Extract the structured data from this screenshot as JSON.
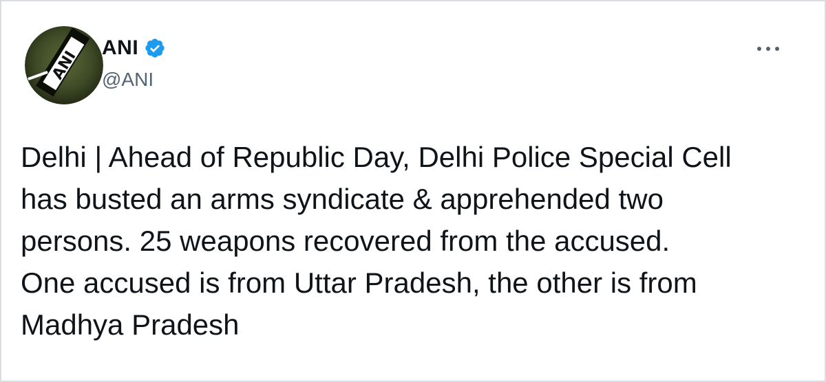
{
  "tweet": {
    "author": {
      "display_name": "ANI",
      "handle": "@ANI",
      "avatar_text": "ANI",
      "verified": true,
      "verified_icon": "verified-badge-icon"
    },
    "menu_icon": "more-horizontal-icon",
    "text": "Delhi | Ahead of Republic Day, Delhi Police Special Cell\nhas busted an arms syndicate & apprehended two\npersons. 25 weapons recovered from the accused.\nOne accused is from Uttar Pradesh, the other is from\nMadhya Pradesh"
  },
  "colors": {
    "text_primary": "#0f1419",
    "text_secondary": "#536471",
    "verified_blue": "#1d9bf0",
    "border": "#d9dde1"
  }
}
